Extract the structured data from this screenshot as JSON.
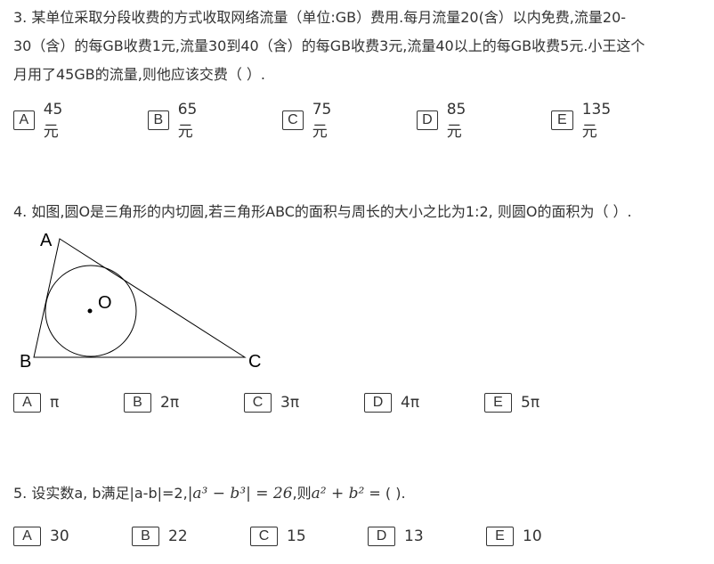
{
  "questions": [
    {
      "lines": [
        "3. 某单位采取分段收费的方式收取网络流量（单位:GB）费用.每月流量20(含）以内免费,流量20-",
        "30（含）的每GB收费1元,流量30到40（含）的每GB收费3元,流量40以上的每GB收费5元.小王这个",
        "月用了45GB的流量,则他应该交费（   ）."
      ],
      "options": [
        {
          "letter": "A",
          "text": "45元"
        },
        {
          "letter": "B",
          "text": "65元"
        },
        {
          "letter": "C",
          "text": "75元"
        },
        {
          "letter": "D",
          "text": "85元"
        },
        {
          "letter": "E",
          "text": "135元"
        }
      ]
    },
    {
      "lines": [
        "4. 如图,圆O是三角形的内切圆,若三角形ABC的面积与周长的大小之比为1:2, 则圆O的面积为（   ）."
      ],
      "figure": {
        "A": "A",
        "B": "B",
        "C": "C",
        "O": "O"
      },
      "options": [
        {
          "letter": "A",
          "text": "π"
        },
        {
          "letter": "B",
          "text": "2π"
        },
        {
          "letter": "C",
          "text": "3π"
        },
        {
          "letter": "D",
          "text": "4π"
        },
        {
          "letter": "E",
          "text": "5π"
        }
      ]
    },
    {
      "prefix": "5. 设实数a, b满足|a-b|=2,",
      "math1": "|a³ − b³| = 26",
      "mid": ",则",
      "math2": "a² + b²",
      "suffix": " = (   ).",
      "options": [
        {
          "letter": "A",
          "text": "30"
        },
        {
          "letter": "B",
          "text": "22"
        },
        {
          "letter": "C",
          "text": "15"
        },
        {
          "letter": "D",
          "text": "13"
        },
        {
          "letter": "E",
          "text": "10"
        }
      ]
    }
  ]
}
